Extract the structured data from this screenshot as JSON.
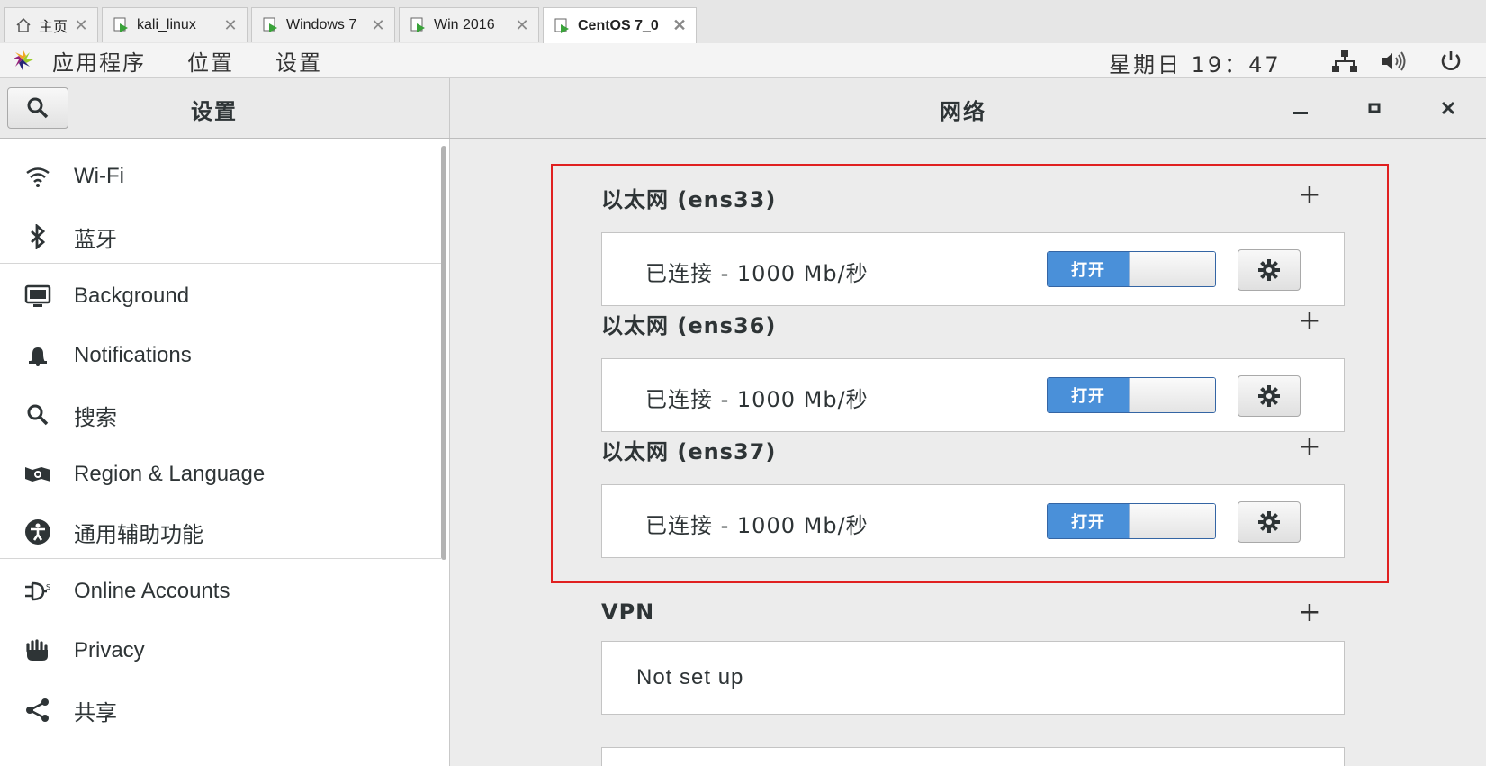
{
  "tabs": [
    {
      "label": "主页",
      "icon": "home-icon"
    },
    {
      "label": "kali_linux",
      "icon": "vm-icon"
    },
    {
      "label": "Windows 7",
      "icon": "vm-icon"
    },
    {
      "label": "Win 2016",
      "icon": "vm-icon"
    },
    {
      "label": "CentOS 7_0",
      "icon": "vm-icon",
      "active": true
    }
  ],
  "topbar": {
    "menus": [
      "应用程序",
      "位置",
      "设置"
    ],
    "clock": "星期日 19：47"
  },
  "header": {
    "left_title": "设置",
    "right_title": "网络"
  },
  "sidebar": {
    "items": [
      {
        "label": "Wi-Fi",
        "icon": "wifi-icon"
      },
      {
        "label": "蓝牙",
        "icon": "bluetooth-icon"
      },
      {
        "label": "Background",
        "icon": "background-icon"
      },
      {
        "label": "Notifications",
        "icon": "bell-icon"
      },
      {
        "label": "搜索",
        "icon": "search-icon"
      },
      {
        "label": "Region & Language",
        "icon": "region-icon"
      },
      {
        "label": "通用辅助功能",
        "icon": "accessibility-icon"
      },
      {
        "label": "Online Accounts",
        "icon": "online-accounts-icon"
      },
      {
        "label": "Privacy",
        "icon": "privacy-hand-icon"
      },
      {
        "label": "共享",
        "icon": "share-icon"
      }
    ]
  },
  "network": {
    "ethernet": [
      {
        "title": "以太网 (ens33)",
        "status": "已连接 - 1000 Mb/秒",
        "toggle": "打开"
      },
      {
        "title": "以太网 (ens36)",
        "status": "已连接 - 1000 Mb/秒",
        "toggle": "打开"
      },
      {
        "title": "以太网 (ens37)",
        "status": "已连接 - 1000 Mb/秒",
        "toggle": "打开"
      }
    ],
    "vpn": {
      "title": "VPN",
      "status": "Not set up"
    }
  },
  "colors": {
    "accent": "#4a90d9",
    "highlight_border": "#e02020"
  }
}
